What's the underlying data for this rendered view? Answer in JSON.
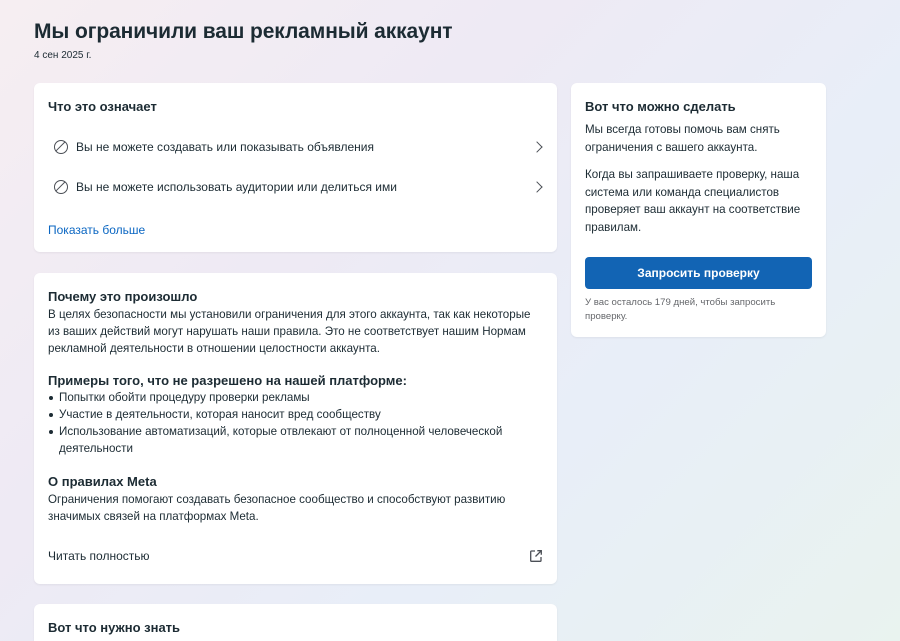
{
  "page": {
    "title": "Мы ограничили ваш рекламный аккаунт",
    "date": "4 сен 2025 г."
  },
  "meaning": {
    "title": "Что это означает",
    "items": [
      {
        "label": "Вы не можете создавать или показывать объявления",
        "icon": "ban-icon"
      },
      {
        "label": "Вы не можете использовать аудитории или делиться ими",
        "icon": "ban-icon"
      }
    ],
    "show_more": "Показать больше"
  },
  "why": {
    "title": "Почему это произошло",
    "text": "В целях безопасности мы установили ограничения для этого аккаунта, так как некоторые из ваших действий могут нарушать наши правила. Это не соответствует нашим Нормам рекламной деятельности в отношении целостности аккаунта.",
    "examples_title": "Примеры того, что не разрешено на нашей платформе:",
    "examples": [
      "Попытки обойти процедуру проверки рекламы",
      "Участие в деятельности, которая наносит вред сообществу",
      "Использование автоматизаций, которые отвлекают от полноценной человеческой деятельности"
    ],
    "rules_title": "О правилах Meta",
    "rules_text": "Ограничения помогают создавать безопасное сообщество и способствуют развитию значимых связей на платформах Meta.",
    "read_full": "Читать полностью",
    "read_full_icon": "external-link-icon"
  },
  "know": {
    "title": "Вот что нужно знать"
  },
  "action": {
    "title": "Вот что можно сделать",
    "text1": "Мы всегда готовы помочь вам снять ограничения с вашего аккаунта.",
    "text2": "Когда вы запрашиваете проверку, наша система или команда специалистов проверяет ваш аккаунт на соответствие правилам.",
    "button": "Запросить проверку",
    "note": "У вас осталось 179 дней, чтобы запросить проверку."
  },
  "colors": {
    "primary_button": "#1264b4",
    "link": "#0a66c2",
    "text": "#1c2b33"
  }
}
